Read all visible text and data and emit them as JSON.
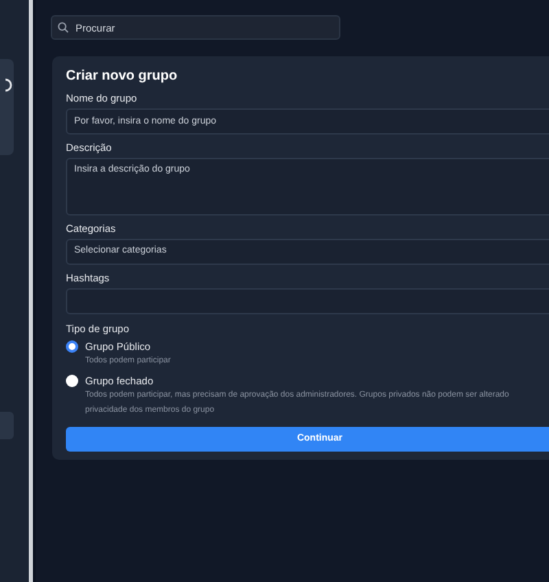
{
  "search": {
    "placeholder": "Procurar"
  },
  "form": {
    "title": "Criar novo grupo",
    "fields": [
      {
        "kind": "input",
        "label": "Nome do grupo",
        "placeholder": "Por favor, insira o nome do grupo"
      },
      {
        "kind": "textarea",
        "label": "Descrição",
        "placeholder": "Insira a descrição do grupo"
      },
      {
        "kind": "select",
        "label": "Categorias",
        "placeholder": "Selecionar categorias"
      },
      {
        "kind": "input",
        "label": "Hashtags"
      }
    ],
    "group_type": {
      "label": "Tipo de grupo",
      "options": [
        {
          "label": "Grupo Público",
          "selected": true,
          "description": [
            "Todos podem participar"
          ]
        },
        {
          "label": "Grupo fechado",
          "selected": false,
          "description": [
            "Todos podem participar, mas precisam de aprovação dos administradores. Grupos privados não podem ser alterado",
            "privacidade dos membros do grupo"
          ]
        }
      ]
    },
    "submit": "Continuar"
  }
}
